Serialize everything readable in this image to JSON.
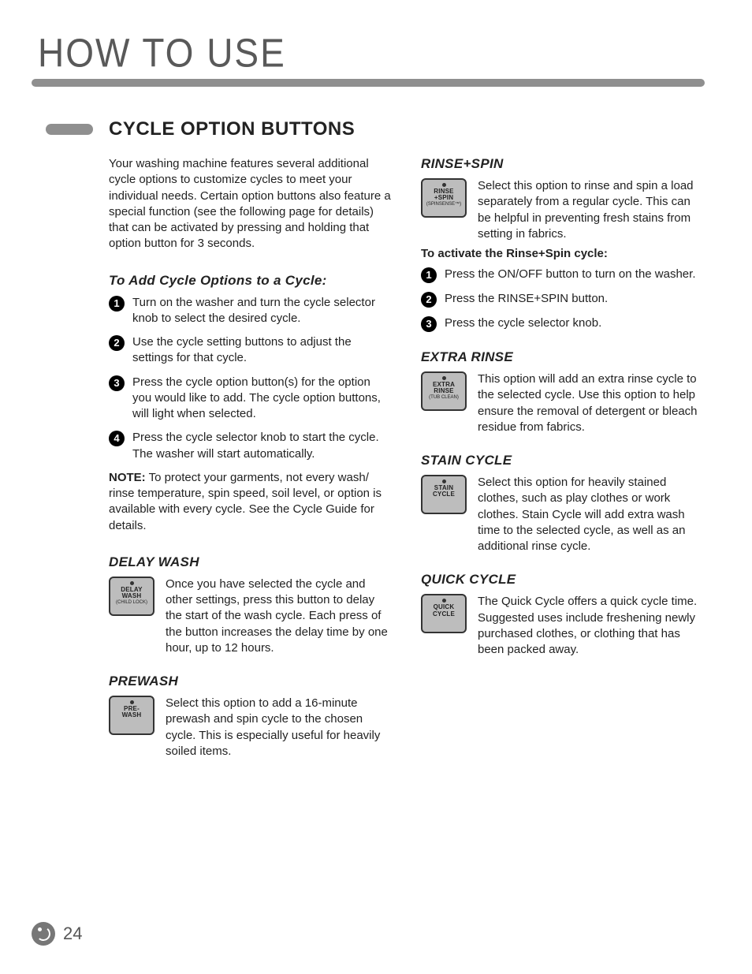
{
  "header": {
    "title": "HOW TO USE"
  },
  "section": {
    "title": "CYCLE OPTION BUTTONS",
    "intro": "Your washing machine features several additional cycle options to customize cycles to meet your individual needs. Certain option buttons also feature a special function (see the following page for details) that can be activated by pressing and holding that option button for 3 seconds."
  },
  "add_cycle": {
    "heading": "To Add Cycle Options to a Cycle:",
    "steps": [
      "Turn on the washer and turn the cycle selector knob to select the desired cycle.",
      "Use the cycle setting buttons to adjust the settings for that cycle.",
      "Press the cycle option button(s) for the option you would like to add. The cycle option buttons, will light when selected.",
      "Press the cycle selector knob to start the cycle. The washer will start automatically."
    ],
    "note_label": "NOTE:",
    "note_text": " To protect your garments, not every wash/ rinse temperature, spin speed, soil level, or option is available with every cycle. See the Cycle Guide for details."
  },
  "delay_wash": {
    "heading": "DELAY WASH",
    "btn_l1": "DELAY\nWASH",
    "btn_l2": "(CHILD LOCK)",
    "text": "Once you have selected the cycle and other settings, press this button to delay the start of the wash cycle. Each press of the button increases the delay time by one hour, up to 12 hours."
  },
  "prewash": {
    "heading": "PREWASH",
    "btn_l1": "PRE-\nWASH",
    "text": "Select this option to add a 16-minute prewash and spin cycle to the chosen cycle. This is especially useful for heavily soiled items."
  },
  "rinse_spin": {
    "heading": "RINSE+SPIN",
    "btn_l1": "RINSE\n+SPIN",
    "btn_l2": "(SPINSENSE™)",
    "text": "Select this option to rinse and spin a load separately from a regular cycle. This can be helpful in preventing fresh stains from setting in fabrics.",
    "activate_heading": "To activate the Rinse+Spin cycle:",
    "steps": [
      "Press the ON/OFF button to turn on the washer.",
      "Press the RINSE+SPIN button.",
      "Press the cycle selector knob."
    ]
  },
  "extra_rinse": {
    "heading": "EXTRA RINSE",
    "btn_l1": "EXTRA\nRINSE",
    "btn_l2": "(TUB CLEAN)",
    "text": "This option will add an extra rinse cycle to the selected cycle. Use this option to help ensure the removal of detergent or bleach residue from fabrics."
  },
  "stain_cycle": {
    "heading": "STAIN CYCLE",
    "btn_l1": "STAIN\nCYCLE",
    "text": "Select this option for heavily stained clothes, such as play clothes or work clothes. Stain Cycle will add extra wash time to the selected cycle, as well as an additional rinse cycle."
  },
  "quick_cycle": {
    "heading": "QUICK CYCLE",
    "btn_l1": "QUICK\nCYCLE",
    "text": "The Quick Cycle offers a quick cycle time. Suggested uses include freshening newly purchased clothes, or clothing that has been packed away."
  },
  "footer": {
    "page": "24"
  }
}
